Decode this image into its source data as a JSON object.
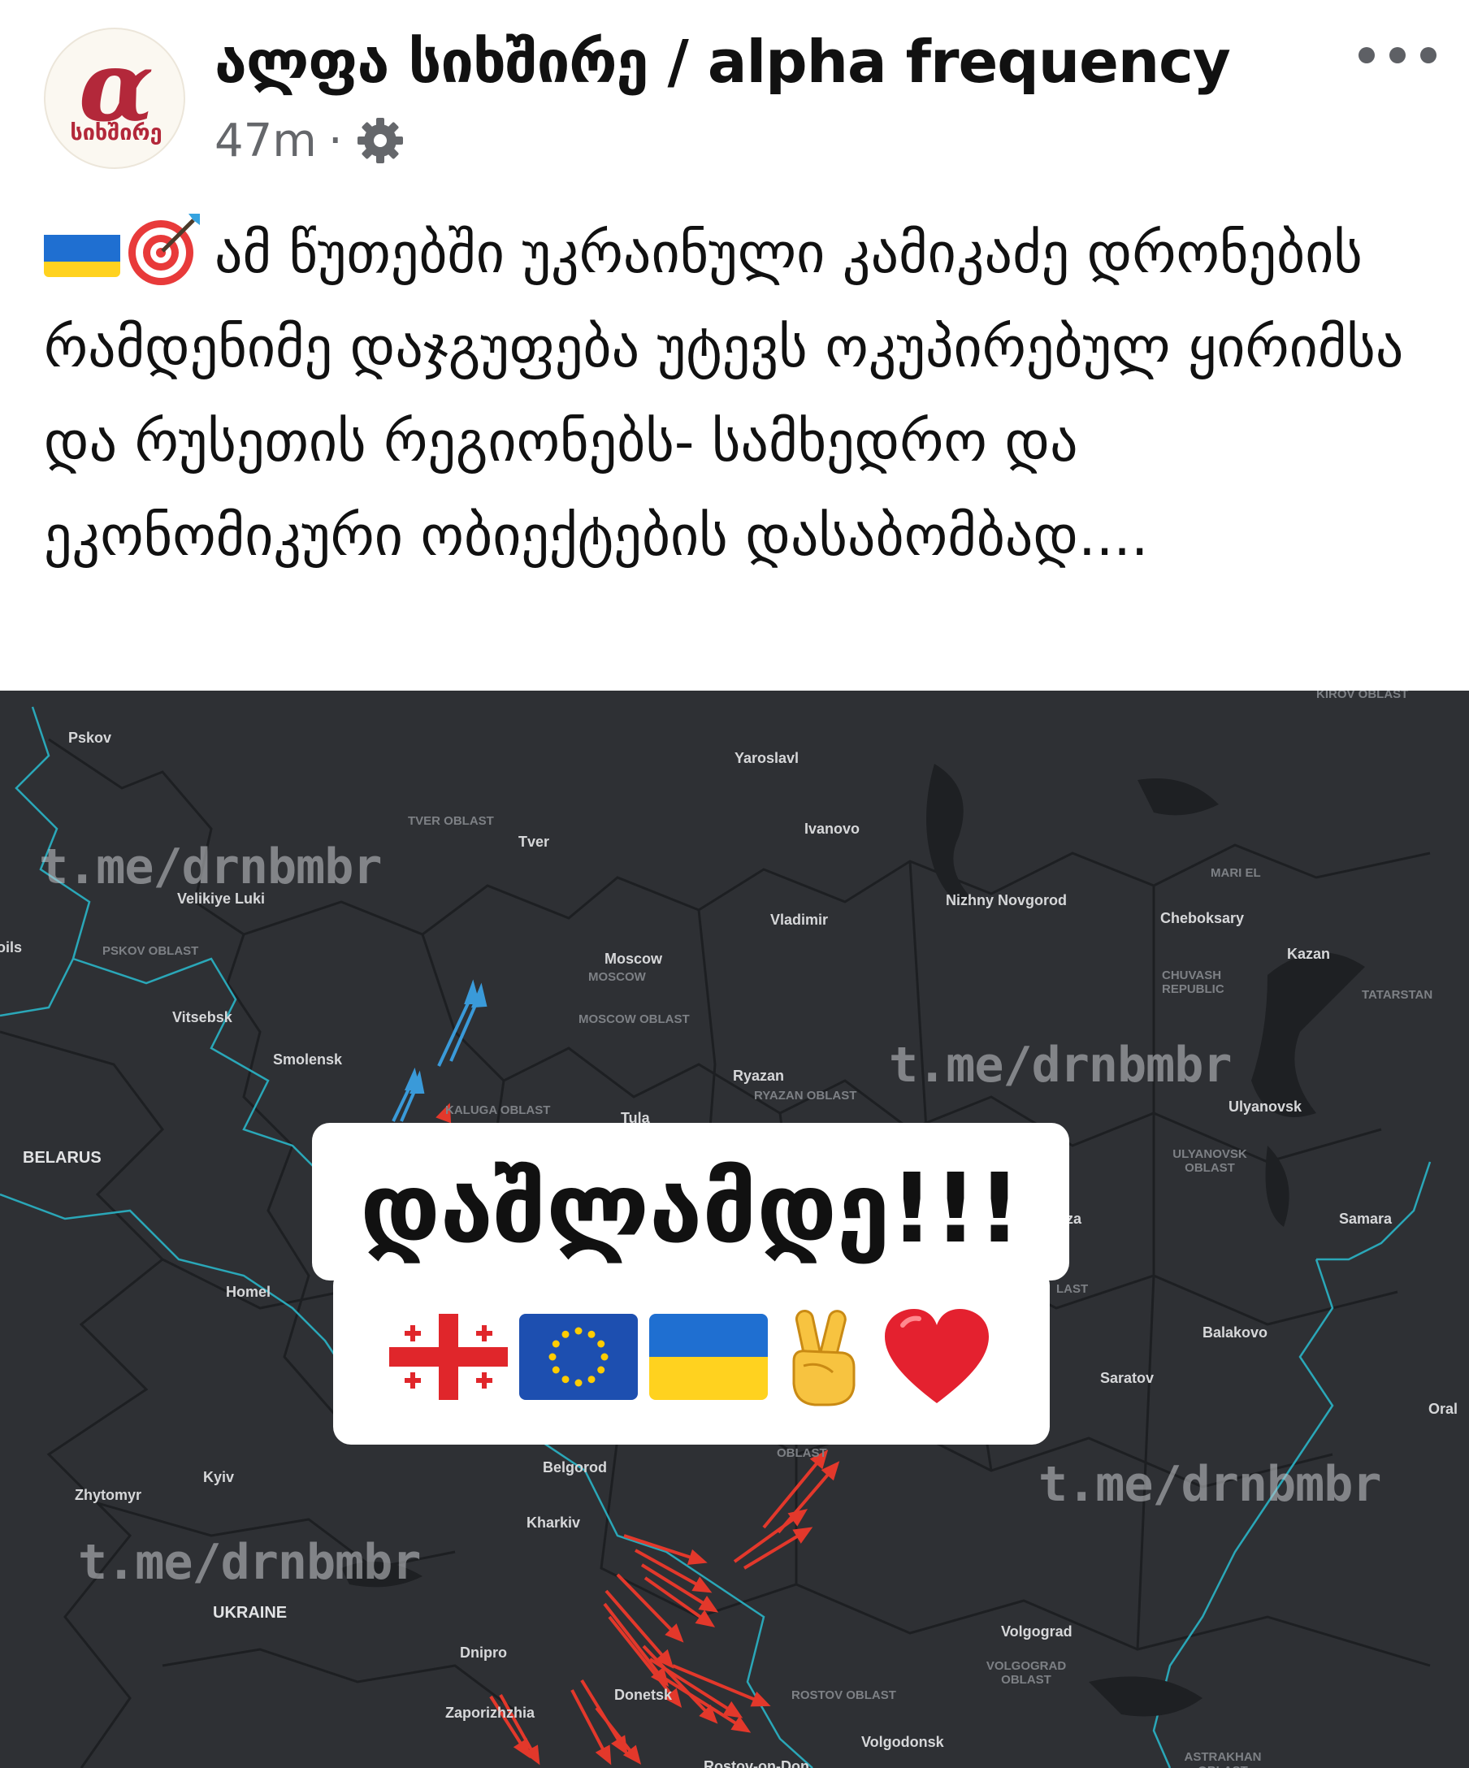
{
  "page": {
    "name": "ალფა სიხშირე / alpha frequency",
    "avatar_text": "სიხშირე",
    "avatar_symbol": "α",
    "time": "47m",
    "separator": "·",
    "privacy_icon": "gear-icon",
    "more_icon": "ellipsis-icon"
  },
  "post": {
    "text": "ამ წუთებში  უკრაინული კამიკაძე დრონების  რამდენიმე დაჯგუფება უტევს ოკუპირებულ ყირიმსა და რუსეთის რეგიონებს- სამხედრო და ეკონომიკური ობიექტების დასაბომბად....",
    "leading_emojis": [
      "ukraine-flag",
      "direct-hit-target"
    ]
  },
  "map": {
    "background": "#2e3034",
    "attack_color": "#e3382b",
    "route_color": "#3a9ad9",
    "watermark": "t.me/drnbmbr",
    "cities": [
      "Pskov",
      "Yaroslavl",
      "Tver",
      "Ivanovo",
      "Velikiye Luki",
      "Nizhny Novgorod",
      "Vladimir",
      "Cheboksary",
      "Kazan",
      "Moscow",
      "Vitsebsk",
      "Smolensk",
      "Ryazan",
      "Tula",
      "Ulyanovsk",
      "Samara",
      "Homel",
      "Balakovo",
      "Saratov",
      "Oral",
      "Belgorod",
      "Kyiv",
      "Zhytomyr",
      "Kharkiv",
      "Volgograd",
      "Dnipro",
      "Donetsk",
      "Zaporizhzhia",
      "Volgodonsk",
      "Rostov-on-Don",
      "za"
    ],
    "regions": [
      "KIROV OBLAST",
      "TVER OBLAST",
      "MARI EL",
      "PSKOV OBLAST",
      "MOSCOW",
      "MOSCOW OBLAST",
      "CHUVASH REPUBLIC",
      "TATARSTAN",
      "RYAZAN OBLAST",
      "KALUGA OBLAST",
      "ULYANOVSK OBLAST",
      "LAST",
      "OBLAST",
      "ROSTOV OBLAST",
      "VOLGOGRAD OBLAST",
      "ASTRAKHAN OBLAST"
    ],
    "countries": [
      "BELARUS",
      "UKRAINE"
    ],
    "edge_label": "oils"
  },
  "banner": {
    "text": "დაშლამდე!!!",
    "emojis": [
      "georgia-flag",
      "eu-flag",
      "ukraine-flag",
      "victory-hand",
      "red-heart"
    ]
  }
}
